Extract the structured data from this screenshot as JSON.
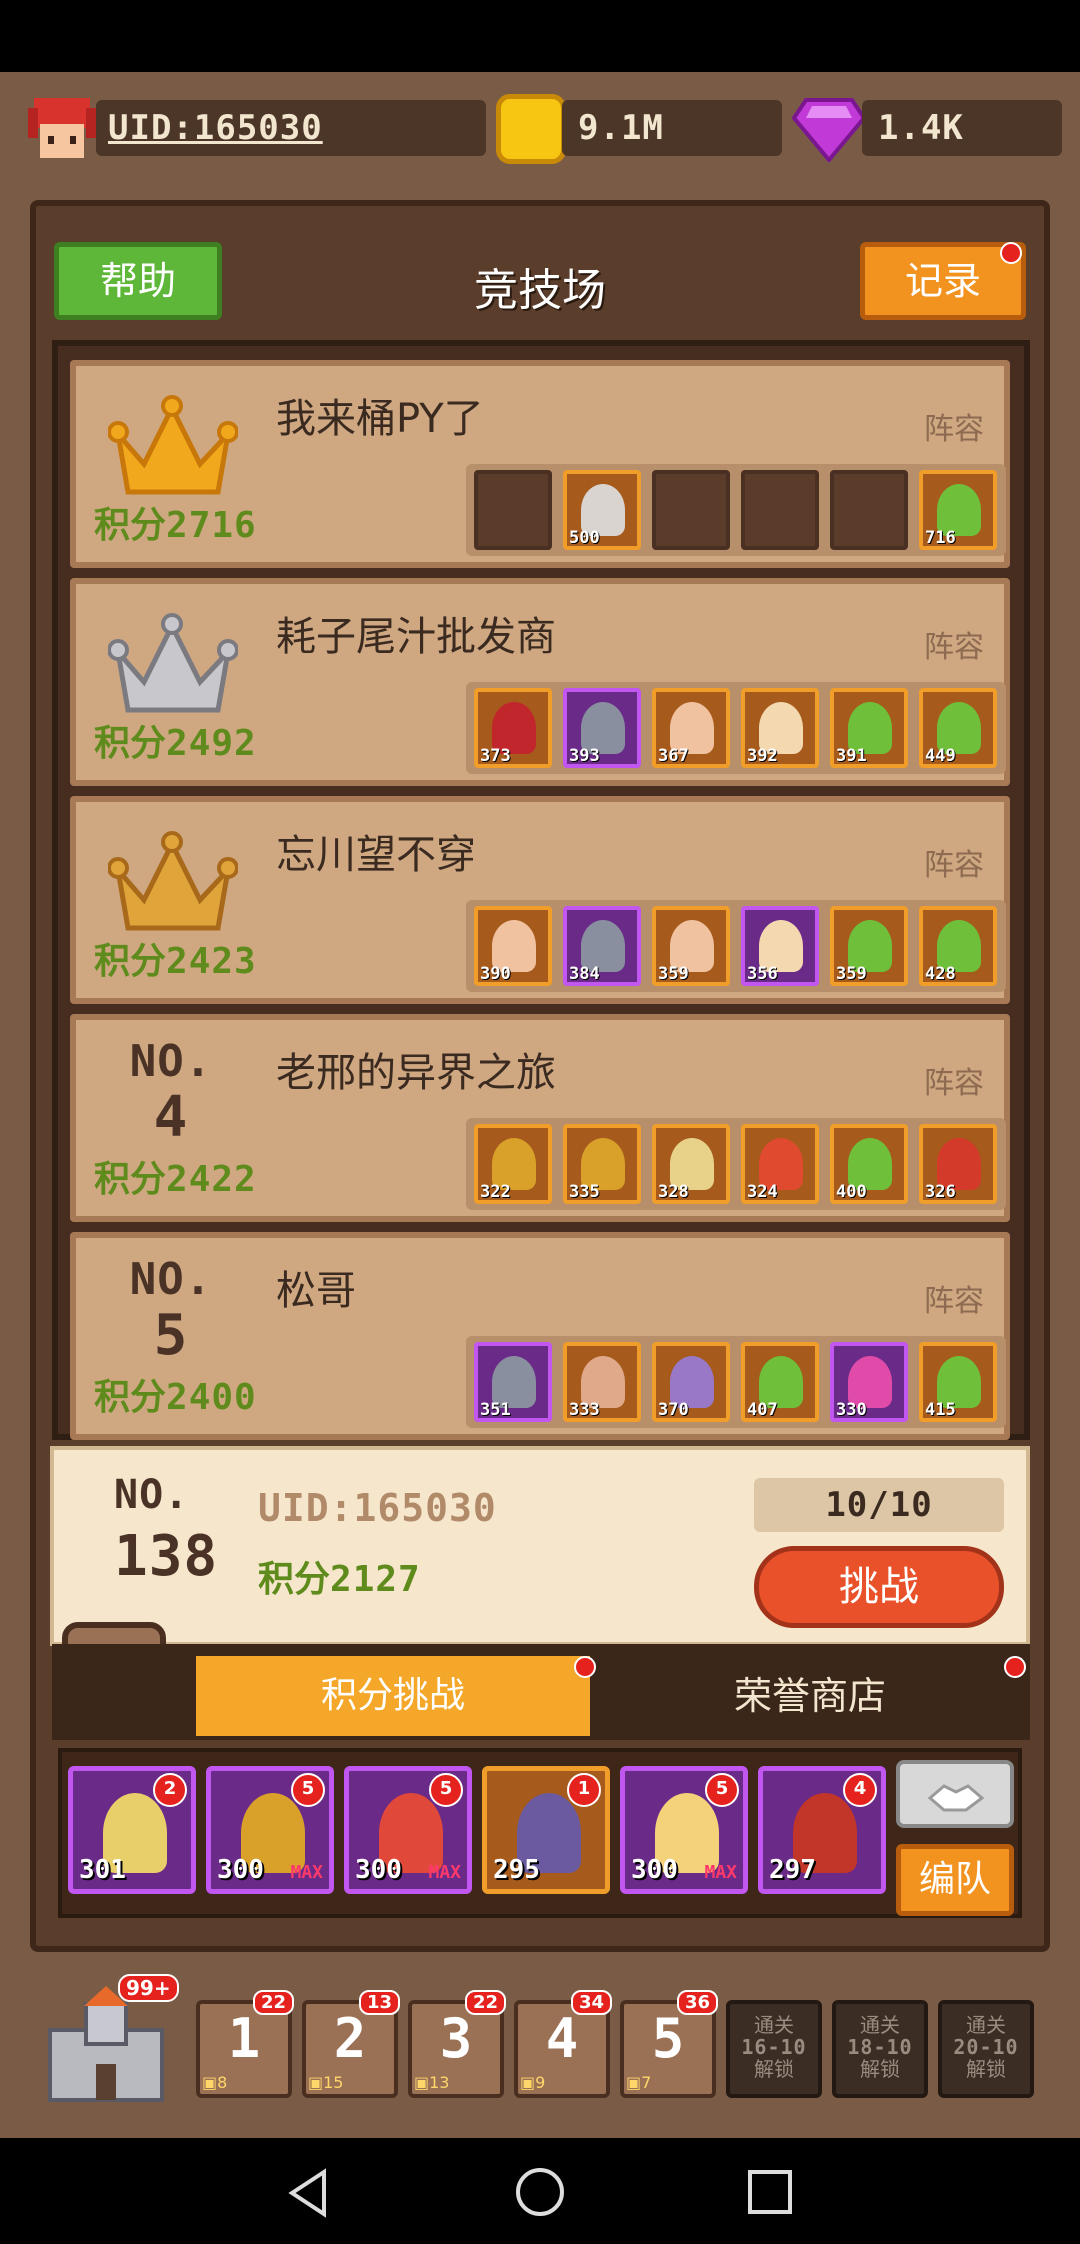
{
  "top_bar": {
    "uid": "UID:165030",
    "gold": "9.1M",
    "gems": "1.4K"
  },
  "header": {
    "help_label": "帮助",
    "title": "竞技场",
    "record_label": "记录"
  },
  "score_prefix": "积分",
  "lineup_label": "阵容",
  "no_label": "NO.",
  "leaderboard": [
    {
      "rank_icon": "gold-crown-icon",
      "name": "我来桶PY了",
      "score": "2716",
      "slots": [
        {
          "t": "empty"
        },
        {
          "t": "gold",
          "lv": "500",
          "c": "#d9d4cf"
        },
        {
          "t": "empty"
        },
        {
          "t": "empty"
        },
        {
          "t": "empty"
        },
        {
          "t": "gold",
          "lv": "716",
          "c": "#6fbf3a"
        }
      ]
    },
    {
      "rank_icon": "silver-crown-icon",
      "name": "耗子尾汁批发商",
      "score": "2492",
      "slots": [
        {
          "t": "gold",
          "lv": "373",
          "c": "#c0262b"
        },
        {
          "t": "purple",
          "lv": "393",
          "c": "#8a8fa0"
        },
        {
          "t": "gold",
          "lv": "367",
          "c": "#f0c2a0"
        },
        {
          "t": "gold",
          "lv": "392",
          "c": "#f3d8b0"
        },
        {
          "t": "gold",
          "lv": "391",
          "c": "#6fbf3a"
        },
        {
          "t": "gold",
          "lv": "449",
          "c": "#6fbf3a"
        }
      ]
    },
    {
      "rank_icon": "bronze-crown-icon",
      "name": "忘川望不穿",
      "score": "2423",
      "slots": [
        {
          "t": "gold",
          "lv": "390",
          "c": "#f0c2a0"
        },
        {
          "t": "purple",
          "lv": "384",
          "c": "#8a8fa0"
        },
        {
          "t": "gold",
          "lv": "359",
          "c": "#f0c2a0"
        },
        {
          "t": "purple",
          "lv": "356",
          "c": "#f3d8b0"
        },
        {
          "t": "gold",
          "lv": "359",
          "c": "#6fbf3a"
        },
        {
          "t": "gold",
          "lv": "428",
          "c": "#6fbf3a"
        }
      ]
    },
    {
      "rank": "4",
      "name": "老邢的异界之旅",
      "score": "2422",
      "slots": [
        {
          "t": "gold",
          "lv": "322",
          "c": "#d9a02a"
        },
        {
          "t": "gold",
          "lv": "335",
          "c": "#d9a02a"
        },
        {
          "t": "gold",
          "lv": "328",
          "c": "#e8d28a"
        },
        {
          "t": "gold",
          "lv": "324",
          "c": "#e04a2e"
        },
        {
          "t": "gold",
          "lv": "400",
          "c": "#6fbf3a"
        },
        {
          "t": "gold",
          "lv": "326",
          "c": "#d43a2a"
        }
      ]
    },
    {
      "rank": "5",
      "name": "松哥",
      "score": "2400",
      "slots": [
        {
          "t": "purple",
          "lv": "351",
          "c": "#8a8fa0"
        },
        {
          "t": "gold",
          "lv": "333",
          "c": "#e0a98a"
        },
        {
          "t": "gold",
          "lv": "370",
          "c": "#9a78c8"
        },
        {
          "t": "gold",
          "lv": "407",
          "c": "#6fbf3a"
        },
        {
          "t": "purple",
          "lv": "330",
          "c": "#e04aa8"
        },
        {
          "t": "gold",
          "lv": "415",
          "c": "#6fbf3a"
        }
      ]
    }
  ],
  "me": {
    "rank": "138",
    "uid": "UID:165030",
    "score": "2127",
    "attempts": "10/10",
    "challenge_label": "挑战"
  },
  "tabs": {
    "score_challenge": "积分挑战",
    "honor_shop": "荣誉商店"
  },
  "team": [
    {
      "lv": "301",
      "max": "",
      "badge": "2",
      "c": "#e8cf6a"
    },
    {
      "lv": "300",
      "max": "MAX",
      "badge": "5",
      "c": "#d9a02a"
    },
    {
      "lv": "300",
      "max": "MAX",
      "badge": "5",
      "c": "#e0483a"
    },
    {
      "lv": "295",
      "max": "",
      "badge": "1",
      "c": "#6b5aa0"
    },
    {
      "lv": "300",
      "max": "MAX",
      "badge": "5",
      "c": "#f3d27a"
    },
    {
      "lv": "297",
      "max": "",
      "badge": "4",
      "c": "#c2362a"
    }
  ],
  "formation_label": "编队",
  "castle_badge": "99+",
  "stages": [
    {
      "num": "1",
      "count": "22",
      "chest": "8"
    },
    {
      "num": "2",
      "count": "13",
      "chest": "15"
    },
    {
      "num": "3",
      "count": "22",
      "chest": "13"
    },
    {
      "num": "4",
      "count": "34",
      "chest": "9"
    },
    {
      "num": "5",
      "count": "36",
      "chest": "7"
    }
  ],
  "locked_stages": [
    {
      "l1": "通关",
      "l2": "16-10",
      "l3": "解锁"
    },
    {
      "l1": "通关",
      "l2": "18-10",
      "l3": "解锁"
    },
    {
      "l1": "通关",
      "l2": "20-10",
      "l3": "解锁"
    }
  ]
}
